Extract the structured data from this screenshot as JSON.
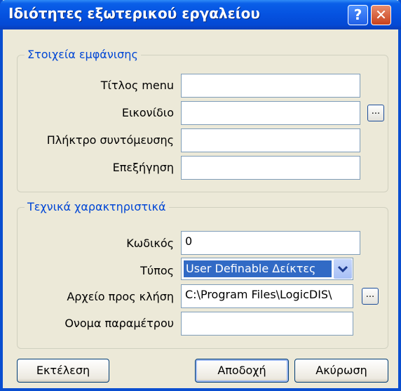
{
  "window": {
    "title": "Ιδιότητες εξωτερικού εργαλείου",
    "help_glyph": "?",
    "close_glyph": "✕"
  },
  "display_group": {
    "legend": "Στοιχεία εμφάνισης",
    "fields": [
      {
        "label": "Τίτλος menu",
        "value": ""
      },
      {
        "label": "Εικονίδιο",
        "value": ""
      },
      {
        "label": "Πλήκτρο συντόμευσης",
        "value": ""
      },
      {
        "label": "Επεξήγηση",
        "value": ""
      }
    ],
    "browse_glyph": "..."
  },
  "tech_group": {
    "legend": "Τεχνικά χαρακτηριστικά",
    "code": {
      "label": "Κωδικός",
      "value": "0"
    },
    "type": {
      "label": "Τύπος",
      "value": "User Definable Δείκτες"
    },
    "file": {
      "label": "Αρχείο προς κλήση",
      "value": "C:\\Program Files\\LogicDIS\\"
    },
    "param": {
      "label": "Ονομα παραμέτρου",
      "value": ""
    },
    "browse_glyph": "..."
  },
  "buttons": {
    "execute": "Εκτέλεση",
    "ok": "Αποδοχή",
    "cancel": "Ακύρωση"
  },
  "colors": {
    "titlebar": "#0552e0",
    "legend": "#0046d5",
    "selection": "#316ac5",
    "face": "#ece9d8"
  }
}
